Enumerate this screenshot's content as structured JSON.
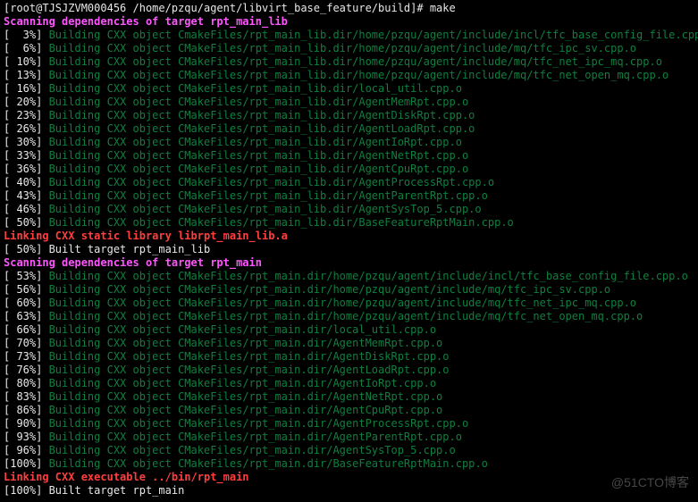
{
  "prompt_line": "[root@TJSJZVM000456 /home/pzqu/agent/libvirt_base_feature/build]# make",
  "watermark": "@51CTO博客",
  "lines": [
    {
      "cls": "magenta",
      "text": "Scanning dependencies of target rpt_main_lib"
    },
    {
      "cls": "build",
      "pct": "  3%",
      "txt": "Building CXX object CmakeFiles/rpt_main_lib.dir/home/pzqu/agent/include/incl/tfc_base_config_file.cpp.o"
    },
    {
      "cls": "build",
      "pct": "  6%",
      "txt": "Building CXX object CMakeFiles/rpt_main_lib.dir/home/pzqu/agent/include/mq/tfc_ipc_sv.cpp.o"
    },
    {
      "cls": "build",
      "pct": " 10%",
      "txt": "Building CXX object CMakeFiles/rpt_main_lib.dir/home/pzqu/agent/include/mq/tfc_net_ipc_mq.cpp.o"
    },
    {
      "cls": "build",
      "pct": " 13%",
      "txt": "Building CXX object CMakeFiles/rpt_main_lib.dir/home/pzqu/agent/include/mq/tfc_net_open_mq.cpp.o"
    },
    {
      "cls": "build",
      "pct": " 16%",
      "txt": "Building CXX object CMakeFiles/rpt_main_lib.dir/local_util.cpp.o"
    },
    {
      "cls": "build",
      "pct": " 20%",
      "txt": "Building CXX object CMakeFiles/rpt_main_lib.dir/AgentMemRpt.cpp.o"
    },
    {
      "cls": "build",
      "pct": " 23%",
      "txt": "Building CXX object CMakeFiles/rpt_main_lib.dir/AgentDiskRpt.cpp.o"
    },
    {
      "cls": "build",
      "pct": " 26%",
      "txt": "Building CXX object CMakeFiles/rpt_main_lib.dir/AgentLoadRpt.cpp.o"
    },
    {
      "cls": "build",
      "pct": " 30%",
      "txt": "Building CXX object CMakeFiles/rpt_main_lib.dir/AgentIoRpt.cpp.o"
    },
    {
      "cls": "build",
      "pct": " 33%",
      "txt": "Building CXX object CMakeFiles/rpt_main_lib.dir/AgentNetRpt.cpp.o"
    },
    {
      "cls": "build",
      "pct": " 36%",
      "txt": "Building CXX object CMakeFiles/rpt_main_lib.dir/AgentCpuRpt.cpp.o"
    },
    {
      "cls": "build",
      "pct": " 40%",
      "txt": "Building CXX object CMakeFiles/rpt_main_lib.dir/AgentProcessRpt.cpp.o"
    },
    {
      "cls": "build",
      "pct": " 43%",
      "txt": "Building CXX object CMakeFiles/rpt_main_lib.dir/AgentParentRpt.cpp.o"
    },
    {
      "cls": "build",
      "pct": " 46%",
      "txt": "Building CXX object CMakeFiles/rpt_main_lib.dir/AgentSysTop_5.cpp.o"
    },
    {
      "cls": "build",
      "pct": " 50%",
      "txt": "Building CXX object CMakeFiles/rpt_main_lib.dir/BaseFeatureRptMain.cpp.o"
    },
    {
      "cls": "red",
      "text": "Linking CXX static library librpt_main_lib.a"
    },
    {
      "cls": "plain",
      "pct": " 50%",
      "txt": "Built target rpt_main_lib"
    },
    {
      "cls": "magenta",
      "text": "Scanning dependencies of target rpt_main"
    },
    {
      "cls": "build",
      "pct": " 53%",
      "txt": "Building CXX object CMakeFiles/rpt_main.dir/home/pzqu/agent/include/incl/tfc_base_config_file.cpp.o"
    },
    {
      "cls": "build",
      "pct": " 56%",
      "txt": "Building CXX object CMakeFiles/rpt_main.dir/home/pzqu/agent/include/mq/tfc_ipc_sv.cpp.o"
    },
    {
      "cls": "build",
      "pct": " 60%",
      "txt": "Building CXX object CMakeFiles/rpt_main.dir/home/pzqu/agent/include/mq/tfc_net_ipc_mq.cpp.o"
    },
    {
      "cls": "build",
      "pct": " 63%",
      "txt": "Building CXX object CMakeFiles/rpt_main.dir/home/pzqu/agent/include/mq/tfc_net_open_mq.cpp.o"
    },
    {
      "cls": "build",
      "pct": " 66%",
      "txt": "Building CXX object CMakeFiles/rpt_main.dir/local_util.cpp.o"
    },
    {
      "cls": "build",
      "pct": " 70%",
      "txt": "Building CXX object CMakeFiles/rpt_main.dir/AgentMemRpt.cpp.o"
    },
    {
      "cls": "build",
      "pct": " 73%",
      "txt": "Building CXX object CMakeFiles/rpt_main.dir/AgentDiskRpt.cpp.o"
    },
    {
      "cls": "build",
      "pct": " 76%",
      "txt": "Building CXX object CMakeFiles/rpt_main.dir/AgentLoadRpt.cpp.o"
    },
    {
      "cls": "build",
      "pct": " 80%",
      "txt": "Building CXX object CMakeFiles/rpt_main.dir/AgentIoRpt.cpp.o"
    },
    {
      "cls": "build",
      "pct": " 83%",
      "txt": "Building CXX object CMakeFiles/rpt_main.dir/AgentNetRpt.cpp.o"
    },
    {
      "cls": "build",
      "pct": " 86%",
      "txt": "Building CXX object CMakeFiles/rpt_main.dir/AgentCpuRpt.cpp.o"
    },
    {
      "cls": "build",
      "pct": " 90%",
      "txt": "Building CXX object CMakeFiles/rpt_main.dir/AgentProcessRpt.cpp.o"
    },
    {
      "cls": "build",
      "pct": " 93%",
      "txt": "Building CXX object CMakeFiles/rpt_main.dir/AgentParentRpt.cpp.o"
    },
    {
      "cls": "build",
      "pct": " 96%",
      "txt": "Building CXX object CMakeFiles/rpt_main.dir/AgentSysTop_5.cpp.o"
    },
    {
      "cls": "build",
      "pct": "100%",
      "txt": "Building CXX object CMakeFiles/rpt_main.dir/BaseFeatureRptMain.cpp.o"
    },
    {
      "cls": "red",
      "text": "Linking CXX executable ../bin/rpt_main"
    },
    {
      "cls": "plain",
      "pct": "100%",
      "txt": "Built target rpt_main"
    }
  ]
}
